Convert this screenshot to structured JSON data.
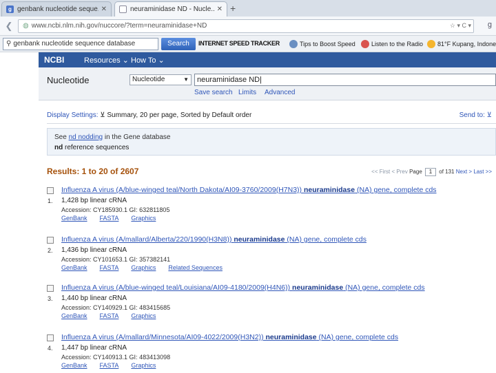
{
  "browser": {
    "tabs": [
      {
        "title": "genbank nucleotide seque...",
        "active": false
      },
      {
        "title": "neuraminidase ND - Nucle...",
        "active": true
      }
    ],
    "new_tab": "+",
    "url": "www.ncbi.nlm.nih.gov/nuccore/?term=neuraminidase+ND",
    "url_tools": "☆ ▾ C ▾"
  },
  "toolbar": {
    "search_value": "genbank nucleotide sequence database",
    "search_button": "Search",
    "brand": "INTERNET SPEED TRACKER",
    "items": [
      {
        "label": "Tips to Boost Speed",
        "icon": "gauge-icon",
        "color": "#6a8fc2"
      },
      {
        "label": "Listen to the Radio",
        "icon": "radio-icon",
        "color": "#d9534f"
      },
      {
        "label": "81°F Kupang, Indone",
        "icon": "sun-icon",
        "color": "#f5b52e"
      }
    ]
  },
  "ncbi": {
    "logo": "NCBI",
    "nav": [
      "Resources",
      "How To"
    ],
    "db_label": "Nucleotide",
    "db_selected": "Nucleotide",
    "term": "neuraminidase ND",
    "sublinks": [
      "Save search",
      "Limits",
      "Advanced"
    ]
  },
  "content": {
    "display_settings_label": "Display Settings:",
    "display_settings_value": "Summary, 20 per page, Sorted by Default order",
    "send_to": "Send to:",
    "gene_box": {
      "prefix": "See ",
      "link": "nd nodding",
      "suffix": " in the Gene database",
      "line2_bold": "nd",
      "line2_rest": " reference sequences"
    },
    "results_head": "Results: 1 to 20 of 2607",
    "pager": {
      "first": "<< First",
      "prev": "< Prev",
      "page_label": "Page",
      "page_value": "1",
      "of": "of 131",
      "next": "Next >",
      "last": "Last >>"
    },
    "results": [
      {
        "num": "1.",
        "title_pre": "Influenza A virus (A/blue-winged teal/North Dakota/AI09-3760/2009(H7N3)) ",
        "title_bold": "neuraminidase",
        "title_post": " (NA) gene, complete cds",
        "desc": "1,428 bp linear cRNA",
        "acc": "Accession: CY185930.1   GI: 632811805",
        "links": [
          "GenBank",
          "FASTA",
          "Graphics"
        ]
      },
      {
        "num": "2.",
        "title_pre": "Influenza A virus (A/mallard/Alberta/220/1990(H3N8)) ",
        "title_bold": "neuraminidase",
        "title_post": " (NA) gene, complete cds",
        "desc": "1,436 bp linear cRNA",
        "acc": "Accession: CY101653.1   GI: 357382141",
        "links": [
          "GenBank",
          "FASTA",
          "Graphics",
          "Related Sequences"
        ]
      },
      {
        "num": "3.",
        "title_pre": "Influenza A virus (A/blue-winged teal/Louisiana/AI09-4180/2009(H4N6)) ",
        "title_bold": "neuraminidase",
        "title_post": " (NA) gene, complete cds",
        "desc": "1,440 bp linear cRNA",
        "acc": "Accession: CY140929.1   GI: 483415685",
        "links": [
          "GenBank",
          "FASTA",
          "Graphics"
        ]
      },
      {
        "num": "4.",
        "title_pre": "Influenza A virus (A/mallard/Minnesota/AI09-4022/2009(H3N2)) ",
        "title_bold": "neuraminidase",
        "title_post": " (NA) gene, complete cds",
        "desc": "1,447 bp linear cRNA",
        "acc": "Accession: CY140913.1   GI: 483413098",
        "links": [
          "GenBank",
          "FASTA",
          "Graphics"
        ]
      }
    ]
  }
}
